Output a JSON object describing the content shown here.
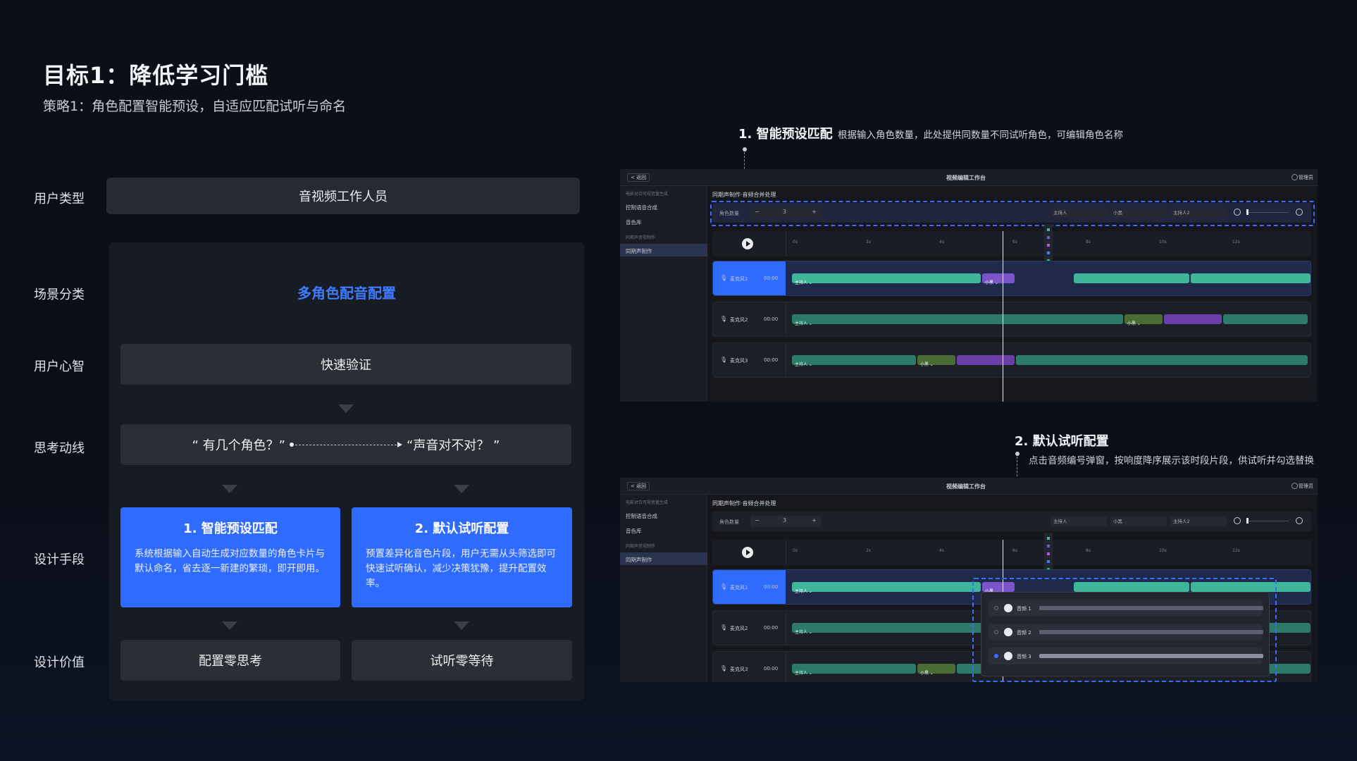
{
  "header": {
    "title": "目标1：降低学习门槛",
    "subtitle": "策略1：角色配置智能预设，自适应匹配试听与命名"
  },
  "rows": {
    "user_type_label": "用户类型",
    "scene_label": "场景分类",
    "mind_label": "用户心智",
    "thinking_label": "思考动线",
    "means_label": "设计手段",
    "value_label": "设计价值"
  },
  "user_type_value": "音视频工作人员",
  "scene_value": "多角色配音配置",
  "mind_value": "快速验证",
  "thinking": {
    "q1": "“ 有几个角色？”",
    "q2": "“声音对不对？ ”"
  },
  "means": [
    {
      "title": "1. 智能预设匹配",
      "desc": "系统根据输入自动生成对应数量的角色卡片与默认命名，省去逐一新建的繁琐，即开即用。"
    },
    {
      "title": "2. 默认试听配置",
      "desc": "预置差异化音色片段，用户无需从头筛选即可快速试听确认，减少决策犹豫，提升配置效率。"
    }
  ],
  "values": [
    "配置零思考",
    "试听零等待"
  ],
  "annotations": {
    "a1_title": "1. 智能预设匹配",
    "a1_desc": "根据输入角色数量，此处提供同数量不同试听角色，可编辑角色名称",
    "a2_title": "2. 默认试听配置",
    "a2_desc": "点击音频编号弹窗，按响度降序展示该时段片段，供试听并勾选替换"
  },
  "app": {
    "back_label": "< 返回",
    "window_title": "视频编辑工作台",
    "user_label": "管理员",
    "sidebar": {
      "group1": "电影对白可视音量生成",
      "item1": "控制语音合成",
      "item2": "音色库",
      "group2": "同期声音视制作",
      "item3": "同期声制作"
    },
    "breadcrumb": "同期声制作·音频合并处理",
    "role_count_label": "角色数量",
    "role_count_value": "3",
    "minus": "−",
    "plus": "+",
    "role_chips": [
      "主持人",
      "小黑",
      "主持人2"
    ],
    "time_ticks": [
      "0s",
      "2s",
      "4s",
      "6s",
      "8s",
      "10s",
      "12s"
    ],
    "tracks": [
      {
        "name": "麦克风1",
        "time": "00:00"
      },
      {
        "name": "麦克风2",
        "time": "00:00"
      },
      {
        "name": "麦克风3",
        "time": "00:00"
      }
    ],
    "seg_host": "主持人 ⌄",
    "seg_xiaohei": "小黑 ⌄",
    "seg_num": "1",
    "popup_items": [
      "音频 1",
      "音频 2",
      "音频 3"
    ]
  },
  "colors": {
    "accent": "#2f6bff",
    "scene_text": "#3f7bff",
    "seg_teal": "#3fb59a",
    "seg_teal_dark": "#2c7a68",
    "seg_purple": "#7a55c9",
    "seg_olive": "#4b6b35"
  }
}
